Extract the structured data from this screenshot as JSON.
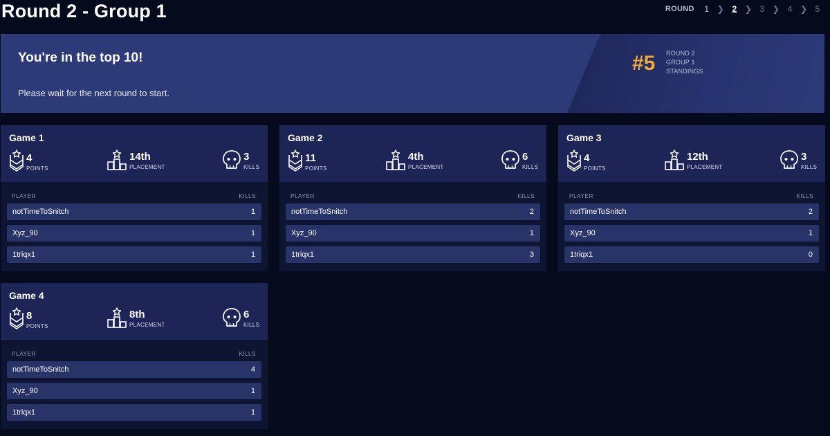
{
  "page": {
    "title": "Round 2 - Group 1"
  },
  "round_nav": {
    "label": "ROUND",
    "rounds": [
      "1",
      "2",
      "3",
      "4",
      "5"
    ],
    "current": "2"
  },
  "banner": {
    "heading": "You're in the top 10!",
    "subtext": "Please wait for the next round to start.",
    "rank": "#5",
    "info_lines": [
      "ROUND 2",
      "GROUP 1",
      "STANDINGS"
    ]
  },
  "stat_labels": {
    "points": "POINTS",
    "placement": "PLACEMENT",
    "kills": "KILLS"
  },
  "table_headers": {
    "player": "PLAYER",
    "kills": "KILLS"
  },
  "games": [
    {
      "title": "Game 1",
      "points": "4",
      "placement": "14th",
      "kills": "3",
      "players": [
        {
          "name": "notTimeToSnitch",
          "kills": "1"
        },
        {
          "name": "Xyz_90",
          "kills": "1"
        },
        {
          "name": "1triqx1",
          "kills": "1"
        }
      ]
    },
    {
      "title": "Game 2",
      "points": "11",
      "placement": "4th",
      "kills": "6",
      "players": [
        {
          "name": "notTimeToSnitch",
          "kills": "2"
        },
        {
          "name": "Xyz_90",
          "kills": "1"
        },
        {
          "name": "1triqx1",
          "kills": "3"
        }
      ]
    },
    {
      "title": "Game 3",
      "points": "4",
      "placement": "12th",
      "kills": "3",
      "players": [
        {
          "name": "notTimeToSnitch",
          "kills": "2"
        },
        {
          "name": "Xyz_90",
          "kills": "1"
        },
        {
          "name": "1triqx1",
          "kills": "0"
        }
      ]
    },
    {
      "title": "Game 4",
      "points": "8",
      "placement": "8th",
      "kills": "6",
      "players": [
        {
          "name": "notTimeToSnitch",
          "kills": "4"
        },
        {
          "name": "Xyz_90",
          "kills": "1"
        },
        {
          "name": "1triqx1",
          "kills": "1"
        }
      ]
    }
  ],
  "colors": {
    "background": "#050a1c",
    "banner": "#2c3a78",
    "card_header": "#1c2556",
    "row": "#283368",
    "rank_accent": "#f5a93b"
  },
  "icons": {
    "points": "chevron-badge-star-icon",
    "placement": "podium-star-icon",
    "kills": "skull-icon"
  }
}
